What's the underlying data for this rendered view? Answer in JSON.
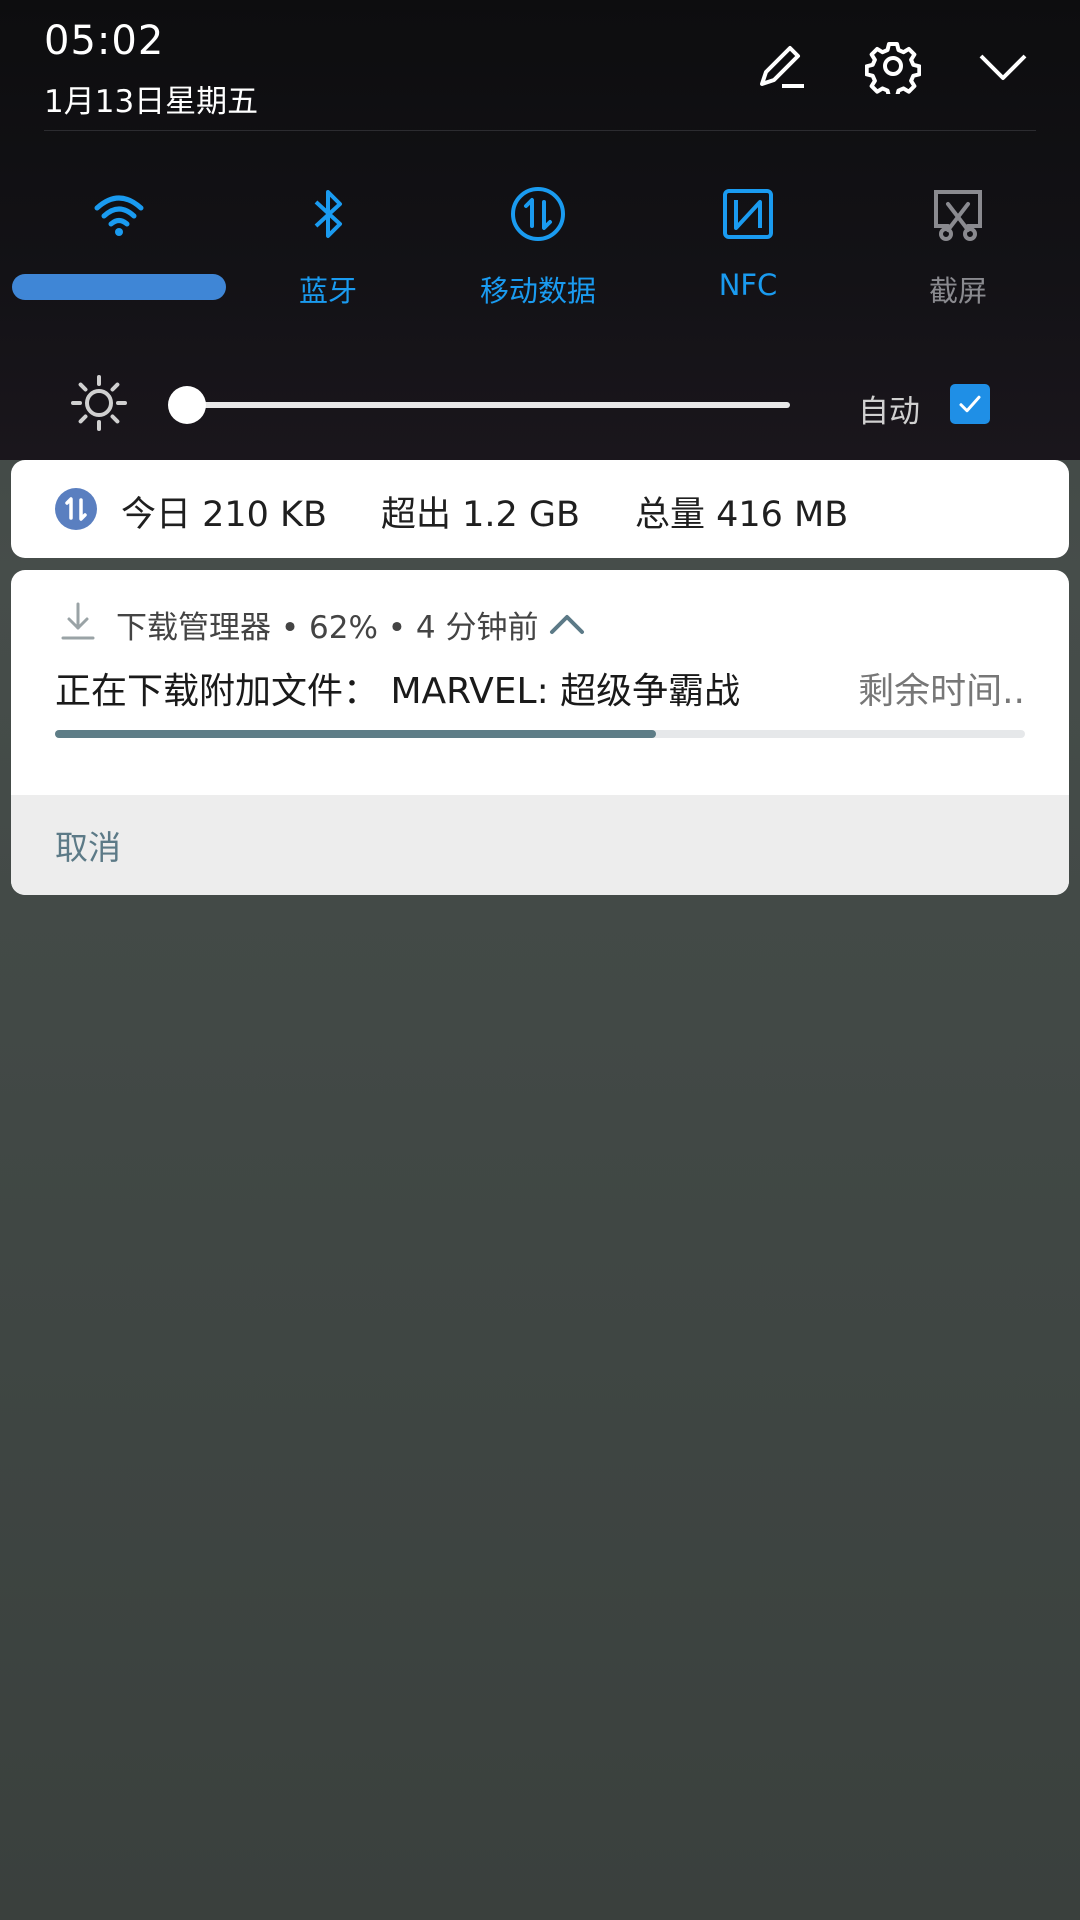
{
  "status": {
    "time": "05:02",
    "date": "1月13日星期五"
  },
  "top_actions": [
    {
      "icon": "pencil-icon"
    },
    {
      "icon": "gear-icon"
    },
    {
      "icon": "chevron-down-icon"
    }
  ],
  "quick_settings": [
    {
      "icon": "wifi-icon",
      "label": "",
      "active": true
    },
    {
      "icon": "bluetooth-icon",
      "label": "蓝牙",
      "active": true
    },
    {
      "icon": "mobile-data-icon",
      "label": "移动数据",
      "active": true
    },
    {
      "icon": "nfc-icon",
      "label": "NFC",
      "active": true
    },
    {
      "icon": "screenshot-icon",
      "label": "截屏",
      "active": false
    }
  ],
  "brightness": {
    "level": 0.0,
    "auto_label": "自动",
    "auto_checked": true
  },
  "data_usage": {
    "today": "今日 210 KB",
    "over": "超出 1.2 GB",
    "total": "总量 416 MB"
  },
  "download": {
    "app_name": "下载管理器",
    "percent_text": "62%",
    "time_ago": "4 分钟前",
    "header": "下载管理器 • 62% • 4 分钟前",
    "title": "正在下载附加文件： MARVEL: 超级争霸战",
    "remaining": "剩余时间..",
    "progress": 0.62,
    "cancel_label": "取消"
  },
  "colors": {
    "accent": "#1a9bf0",
    "progress": "#5e7d87",
    "cancel": "#5c7a87"
  }
}
